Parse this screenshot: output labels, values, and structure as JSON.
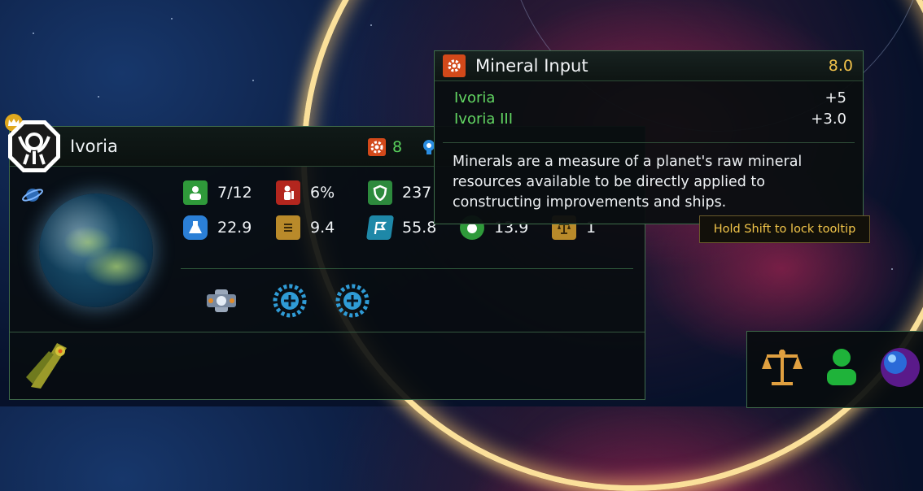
{
  "planet_panel": {
    "name": "Ivoria",
    "header_resources": [
      {
        "icon": "gear-icon",
        "value": "8",
        "color": "#58d05c"
      },
      {
        "icon": "lightbulb-icon",
        "value": ""
      }
    ],
    "stats_row1": [
      {
        "icon": "population-icon",
        "value": "7/12"
      },
      {
        "icon": "worker-icon",
        "value": "6%"
      },
      {
        "icon": "shield-icon",
        "value": "237"
      }
    ],
    "stats_row2": [
      {
        "icon": "science-flask-icon",
        "value": "22.9"
      },
      {
        "icon": "credits-icon",
        "value": "9.4"
      },
      {
        "icon": "influence-flag-icon",
        "value": "55.8"
      },
      {
        "icon": "food-icon",
        "value": "13.9"
      },
      {
        "icon": "approval-scales-icon",
        "value": "1"
      }
    ],
    "slots": [
      "space-station-icon",
      "add-slot-icon",
      "add-slot-icon"
    ]
  },
  "tooltip": {
    "title": "Mineral Input",
    "total": "8.0",
    "rows": [
      {
        "label": "Ivoria",
        "value": "+5"
      },
      {
        "label": "Ivoria III",
        "value": "+3.0"
      }
    ],
    "description": "Minerals are a measure of a planet's raw mineral resources available to be directly applied to constructing improvements and ships."
  },
  "lock_hint": "Hold Shift to lock tooltip",
  "colors": {
    "accent_green": "#58d05c",
    "gold": "#f0c14a",
    "mineral_orange": "#d2491a",
    "panel_border": "#3f6b4a"
  }
}
